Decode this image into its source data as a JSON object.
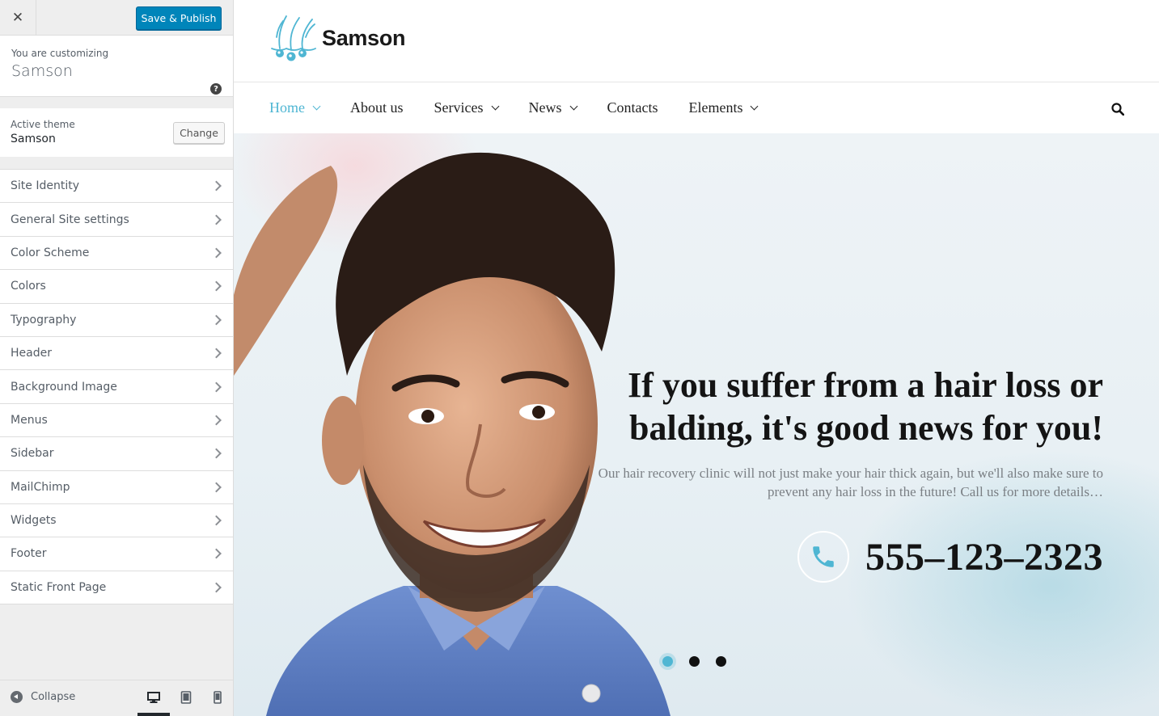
{
  "customizer": {
    "close_icon": "close-icon",
    "save_label": "Save & Publish",
    "customizing_label": "You are customizing",
    "site_name": "Samson",
    "help_icon": "question-circle-icon",
    "active_theme_label": "Active theme",
    "active_theme_name": "Samson",
    "change_label": "Change",
    "sections": [
      {
        "label": "Site Identity"
      },
      {
        "label": "General Site settings"
      },
      {
        "label": "Color Scheme"
      },
      {
        "label": "Colors"
      },
      {
        "label": "Typography"
      },
      {
        "label": "Header"
      },
      {
        "label": "Background Image"
      },
      {
        "label": "Menus"
      },
      {
        "label": "Sidebar"
      },
      {
        "label": "MailChimp"
      },
      {
        "label": "Widgets"
      },
      {
        "label": "Footer"
      },
      {
        "label": "Static Front Page"
      }
    ],
    "collapse_label": "Collapse",
    "devices": [
      "desktop-icon",
      "tablet-icon",
      "mobile-icon"
    ],
    "active_device": "desktop"
  },
  "site": {
    "logo_text": "Samson",
    "nav": [
      {
        "label": "Home",
        "active": true,
        "has_dropdown": true
      },
      {
        "label": "About us",
        "active": false,
        "has_dropdown": false
      },
      {
        "label": "Services",
        "active": false,
        "has_dropdown": true
      },
      {
        "label": "News",
        "active": false,
        "has_dropdown": true
      },
      {
        "label": "Contacts",
        "active": false,
        "has_dropdown": false
      },
      {
        "label": "Elements",
        "active": false,
        "has_dropdown": true
      }
    ],
    "hero": {
      "title": "If you suffer from a hair loss or balding, it's good news for you!",
      "subtitle": "Our hair recovery clinic will not just make your hair thick again, but we'll also make sure to prevent any hair loss in the future!  Call us for more details…",
      "phone": "555–123–2323",
      "slides": 3,
      "active_slide": 1
    },
    "colors": {
      "accent": "#4fb6d3",
      "wp_blue": "#0085ba"
    }
  }
}
